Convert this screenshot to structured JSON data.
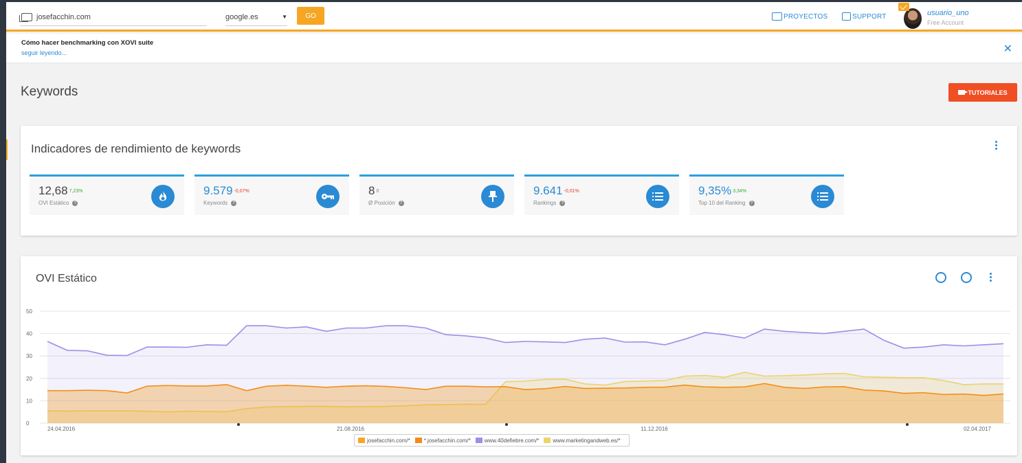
{
  "topbar": {
    "domain": "josefacchin.com",
    "engine": "google.es",
    "go_label": "GO",
    "proyectos_label": "PROYECTOS",
    "support_label": "SUPPORT",
    "user_name": "usuario_uno",
    "user_plan": "Free Account"
  },
  "notice": {
    "title": "Cómo hacer benchmarking con XOVI suite",
    "link": "seguir leyendo..."
  },
  "page": {
    "title": "Keywords",
    "tutorials_label": "TUTORIALES"
  },
  "kpi_card": {
    "title": "Indicadores de rendimiento de keywords",
    "items": [
      {
        "value": "12,68",
        "delta": "7,23%",
        "delta_type": "pos",
        "label": "OVI Estático",
        "icon": "flame-icon"
      },
      {
        "value": "9.579",
        "delta": "-0,07%",
        "delta_type": "neg",
        "label": "Keywords",
        "icon": "key-icon"
      },
      {
        "value": "8",
        "delta": "0",
        "delta_type": "neu",
        "label": "Ø Posición",
        "icon": "pin-icon"
      },
      {
        "value": "9.641",
        "delta": "-0,01%",
        "delta_type": "neg",
        "label": "Rankings",
        "icon": "list-icon"
      },
      {
        "value": "9,35%",
        "delta": "3,34%",
        "delta_type": "pos",
        "label": "Top 10 del Ranking",
        "icon": "list-icon"
      }
    ]
  },
  "chart_card": {
    "title": "OVI Estático"
  },
  "chart_data": {
    "type": "area",
    "ylim": [
      0,
      50
    ],
    "yticks": [
      0,
      10,
      20,
      30,
      40,
      50
    ],
    "xtick_labels": [
      "24.04.2016",
      "21.08.2016",
      "11.12.2016",
      "02.04.2017"
    ],
    "series": [
      {
        "name": "josefacchin.com/*",
        "color": "#f6a623",
        "values": [
          14.5,
          14.5,
          14.7,
          14.5,
          13.5,
          16.5,
          16.8,
          16.6,
          16.6,
          17.2,
          14.5,
          16.5,
          16.9,
          16.5,
          16,
          16.5,
          16.7,
          16.4,
          15.8,
          15,
          16.5,
          16.5,
          16.2,
          16.3,
          15,
          15.4,
          16.4,
          15.5,
          15.6,
          15.7,
          16,
          16.1,
          17,
          16.2,
          16,
          16.2,
          17.7,
          16,
          15.5,
          16.2,
          16.3,
          14.8,
          14.4,
          13.3,
          13.6,
          12.8,
          13,
          12.4,
          13
        ]
      },
      {
        "name": "*.josefacchin.com/*",
        "color": "#f08a1c",
        "values": [
          14.5,
          14.5,
          14.7,
          14.5,
          13.5,
          16.5,
          16.8,
          16.6,
          16.6,
          17.2,
          14.5,
          16.5,
          16.9,
          16.5,
          16,
          16.5,
          16.7,
          16.4,
          15.8,
          15,
          16.5,
          16.5,
          16.2,
          16.3,
          15,
          15.4,
          16.4,
          15.5,
          15.6,
          15.7,
          16,
          16.1,
          17,
          16.2,
          16,
          16.2,
          17.7,
          16,
          15.5,
          16.2,
          16.3,
          14.8,
          14.4,
          13.3,
          13.6,
          12.8,
          13,
          12.4,
          13
        ]
      },
      {
        "name": "www.40defiebre.com/*",
        "color": "#9b8fe6",
        "values": [
          36.5,
          32.5,
          32.3,
          30.3,
          30.2,
          34,
          34,
          33.9,
          35,
          34.8,
          43.5,
          43.5,
          42.5,
          43,
          41,
          42.5,
          42.5,
          43.5,
          43.5,
          42.5,
          39.5,
          39,
          38,
          36,
          36.5,
          36.3,
          36,
          37.5,
          38,
          36.2,
          36.3,
          35,
          37.5,
          40.5,
          39.5,
          38,
          42,
          41,
          40.5,
          40,
          41,
          42,
          37,
          33.5,
          34,
          35,
          34.5,
          35,
          35.5
        ]
      },
      {
        "name": "www.marketingandweb.es/*",
        "color": "#ecd36a",
        "values": [
          5.5,
          5.4,
          5.5,
          5.5,
          5.5,
          5.3,
          5,
          5.3,
          5.2,
          5.1,
          6.5,
          7.2,
          7.4,
          7.5,
          7.5,
          7.3,
          7.4,
          7.5,
          7.8,
          8.2,
          8.3,
          8.5,
          8.4,
          18.5,
          18.8,
          19.5,
          19.6,
          17.5,
          17,
          18.6,
          18.8,
          19,
          21,
          21.3,
          20.5,
          22.7,
          21,
          21.2,
          21.5,
          22,
          22.2,
          20.7,
          20.5,
          20.3,
          20.3,
          19,
          17.2,
          17.5,
          17.5
        ]
      }
    ]
  }
}
